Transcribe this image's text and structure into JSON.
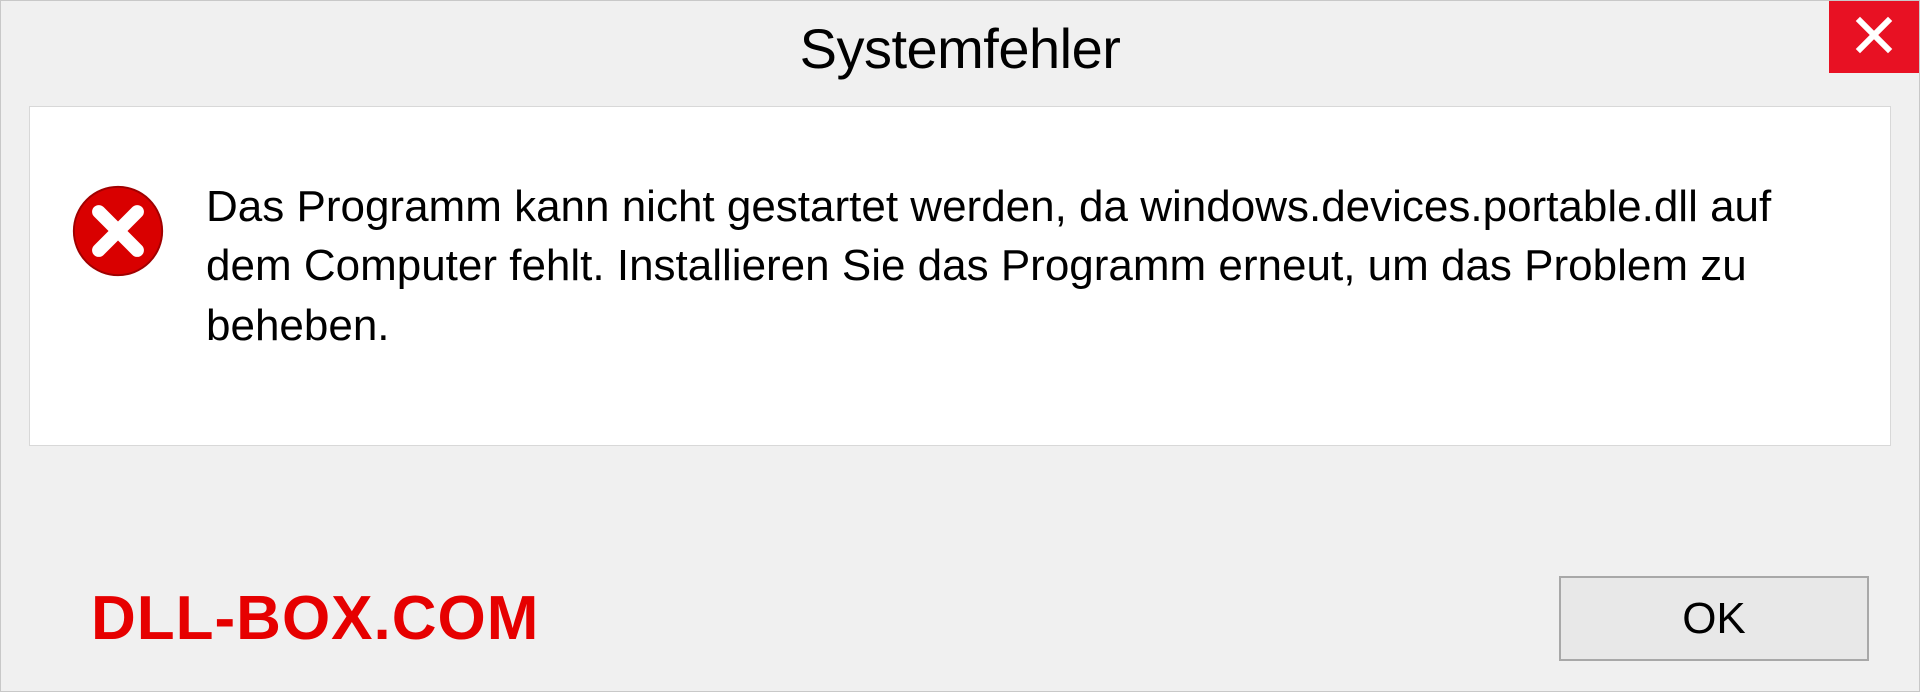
{
  "dialog": {
    "title": "Systemfehler",
    "message": "Das Programm kann nicht gestartet werden, da windows.devices.portable.dll auf dem Computer fehlt. Installieren Sie das Programm erneut, um das Problem zu beheben.",
    "ok_label": "OK"
  },
  "watermark": "DLL-BOX.COM",
  "colors": {
    "close_bg": "#e81123",
    "error_icon": "#d90000",
    "watermark": "#e60000"
  }
}
